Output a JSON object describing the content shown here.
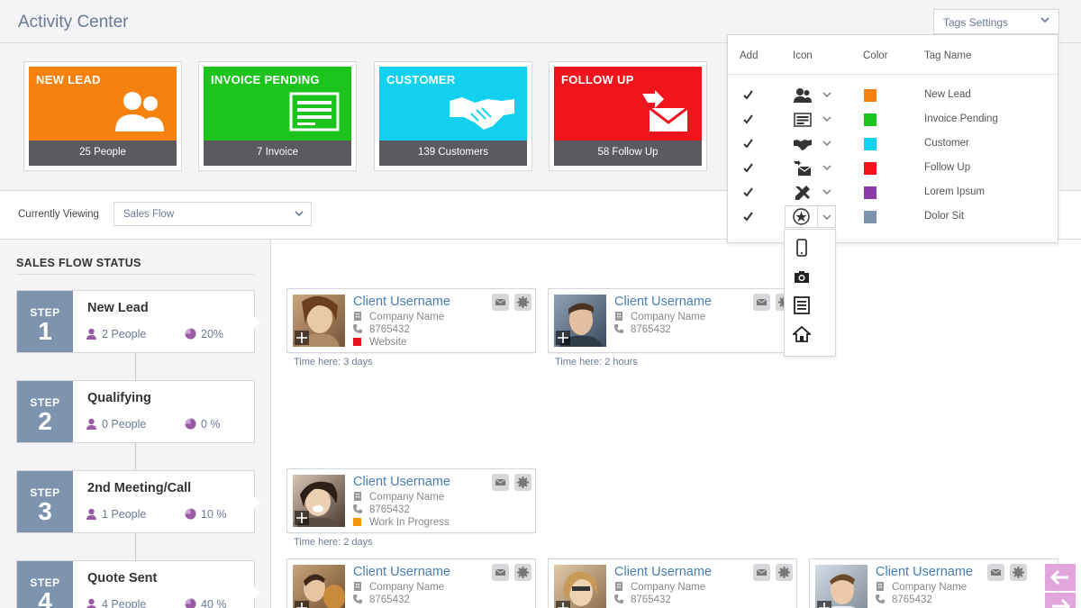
{
  "header": {
    "title": "Activity Center",
    "tags_button": "Tags Settings"
  },
  "tiles": [
    {
      "title": "NEW LEAD",
      "count": "25 People",
      "color": "#f5820f",
      "icon": "users-icon"
    },
    {
      "title": "INVOICE PENDING",
      "count": "7 Invoice",
      "color": "#1ec41e",
      "icon": "invoice-icon"
    },
    {
      "title": "CUSTOMER",
      "count": "139 Customers",
      "color": "#12d0f0",
      "icon": "handshake-icon"
    },
    {
      "title": "FOLLOW UP",
      "count": "58 Follow Up",
      "color": "#f0141c",
      "icon": "mail-reply-icon"
    }
  ],
  "viewing": {
    "label": "Currently Viewing",
    "selected": "Sales Flow"
  },
  "sales_flow": {
    "title": "SALES FLOW STATUS",
    "step_word": "STEP",
    "steps": [
      {
        "num": "1",
        "name": "New Lead",
        "people": "2 People",
        "pct": "20%"
      },
      {
        "num": "2",
        "name": "Qualifying",
        "people": "0 People",
        "pct": "0 %"
      },
      {
        "num": "3",
        "name": "2nd Meeting/Call",
        "people": "1 People",
        "pct": "10 %"
      },
      {
        "num": "4",
        "name": "Quote Sent",
        "people": "4 People",
        "pct": "40 %"
      }
    ]
  },
  "cards": [
    {
      "name": "Client Username",
      "company": "Company Name",
      "phone": "8765432",
      "tag": "Website",
      "tag_color": "#e8141c",
      "time": "Time here: 3 days"
    },
    {
      "name": "Client Username",
      "company": "Company Name",
      "phone": "8765432",
      "tag": "",
      "time": "Time here: 2 hours"
    },
    {
      "name": "Client Username",
      "company": "Company Name",
      "phone": "8765432",
      "tag": "Work In Progress",
      "tag_color": "#f5960f",
      "time": "Time here: 2 days"
    },
    {
      "name": "Client Username",
      "company": "Company Name",
      "phone": "8765432"
    },
    {
      "name": "Client Username",
      "company": "Company Name",
      "phone": "8765432"
    },
    {
      "name": "Client Username",
      "company": "Company Name",
      "phone": "8765432"
    }
  ],
  "tags_panel": {
    "headers": {
      "add": "Add",
      "icon": "Icon",
      "color": "Color",
      "tag_name": "Tag Name"
    },
    "rows": [
      {
        "name": "New Lead",
        "color": "#f5820f",
        "icon": "users-icon"
      },
      {
        "name": "Invoice Pending",
        "color": "#1ec41e",
        "icon": "invoice-icon"
      },
      {
        "name": "Customer",
        "color": "#12d0f0",
        "icon": "handshake-icon"
      },
      {
        "name": "Follow Up",
        "color": "#f0141c",
        "icon": "mail-reply-icon"
      },
      {
        "name": "Lorem Ipsum",
        "color": "#8a3aa8",
        "icon": "tools-icon"
      },
      {
        "name": "Dolor Sit",
        "color": "#7e93ad",
        "icon": "star-icon"
      }
    ],
    "icon_options": [
      "mobile-icon",
      "camera-icon",
      "document-icon",
      "home-icon"
    ]
  }
}
